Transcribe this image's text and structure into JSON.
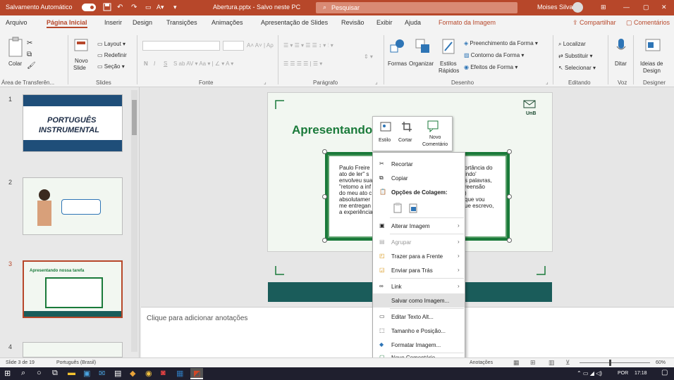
{
  "titlebar": {
    "autosave": "Salvamento Automático",
    "document": "Abertura.pptx - Salvo neste PC",
    "search": "Pesquisar",
    "user": "Moises Silva",
    "accent": "#b7472a"
  },
  "tabs": [
    "Arquivo",
    "Página Inicial",
    "Inserir",
    "Design",
    "Transições",
    "Animações",
    "Apresentação de Slides",
    "Revisão",
    "Exibir",
    "Ajuda",
    "Formato da Imagem"
  ],
  "tabs_right": {
    "share": "Compartilhar",
    "comments": "Comentários"
  },
  "ribbon": {
    "clipboard": {
      "paste": "Colar",
      "label": "Área de Transferên..."
    },
    "slides": {
      "new": "Novo",
      "new2": "Slide",
      "layout": "Layout",
      "reset": "Redefinir",
      "section": "Seção",
      "label": "Slides"
    },
    "font": {
      "bold": "N",
      "italic": "I",
      "underline": "S",
      "label": "Fonte"
    },
    "paragraph": {
      "label": "Parágrafo"
    },
    "drawing": {
      "shapes": "Formas",
      "arrange": "Organizar",
      "styles": "Estilos",
      "styles2": "Rápidos",
      "fill": "Preenchimento da Forma",
      "outline": "Contorno da Forma",
      "effects": "Efeitos de Forma",
      "label": "Desenho"
    },
    "editing": {
      "find": "Localizar",
      "replace": "Substituir",
      "select": "Selecionar",
      "label": "Editando"
    },
    "voice": {
      "dictate": "Ditar",
      "label": "Voz"
    },
    "designer": {
      "ideas": "Ideias de",
      "ideas2": "Design",
      "label": "Designer"
    }
  },
  "thumbnails": [
    {
      "num": "1",
      "title1": "PORTUGUÊS",
      "title2": "INSTRUMENTAL"
    },
    {
      "num": "2"
    },
    {
      "num": "3",
      "heading": "Apresentando nossa tarefa"
    },
    {
      "num": "4"
    }
  ],
  "slide": {
    "title": "Apresentando",
    "logo": "UnB",
    "body": [
      "Paulo Freire",
      "ato de ler\" s",
      "envolveu sua",
      "\"retomo a inf",
      "do meu ato c",
      "absolutamer",
      "me entregan",
      "a experiência"
    ],
    "body_right": [
      "ortância do",
      "indo'",
      "s palavras,",
      "reensão",
      ")",
      "que vou",
      "ue escrevo,",
      ""
    ]
  },
  "minitoolbar": {
    "style": "Estilo",
    "crop": "Cortar",
    "new_comment": "Novo",
    "new_comment2": "Comentário"
  },
  "contextmenu": [
    {
      "label": "Recortar",
      "icon": "scissors-icon"
    },
    {
      "label": "Copiar",
      "icon": "copy-icon"
    },
    {
      "label": "Opções de Colagem:",
      "icon": "paste-icon",
      "bold": true
    },
    {
      "label": "Alterar Imagem",
      "icon": "change-image-icon",
      "arrow": true
    },
    {
      "label": "Agrupar",
      "icon": "group-icon",
      "arrow": true,
      "disabled": true
    },
    {
      "label": "Trazer para a Frente",
      "icon": "bring-front-icon",
      "arrow": true
    },
    {
      "label": "Enviar para Trás",
      "icon": "send-back-icon",
      "arrow": true
    },
    {
      "label": "Link",
      "icon": "link-icon",
      "arrow": true
    },
    {
      "label": "Salvar como Imagem...",
      "icon": "",
      "highlight": true
    },
    {
      "label": "Editar Texto Alt...",
      "icon": "alt-text-icon"
    },
    {
      "label": "Tamanho e Posição...",
      "icon": "size-position-icon"
    },
    {
      "label": "Formatar Imagem...",
      "icon": "format-image-icon"
    },
    {
      "label": "Novo Comentário",
      "icon": "comment-icon"
    }
  ],
  "notes": {
    "placeholder": "Clique para adicionar anotações"
  },
  "status": {
    "slide": "Slide 3 de 19",
    "language": "Português (Brasil)",
    "notes": "Anotações",
    "zoom": "60%"
  },
  "taskbar": {
    "lang": "POR",
    "time": "17:18"
  }
}
